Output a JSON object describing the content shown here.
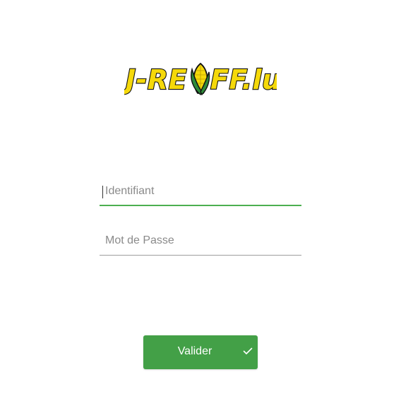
{
  "brand": {
    "logo_text": "J-REIFF.lu",
    "logo_icon": "corn-cob-icon",
    "colors": {
      "yellow": "#f5d90a",
      "outline": "#111111",
      "leaf_green": "#2e8b3a"
    }
  },
  "form": {
    "username": {
      "placeholder": "Identifiant",
      "value": ""
    },
    "password": {
      "placeholder": "Mot de Passe",
      "value": ""
    },
    "submit": {
      "label": "Valider",
      "icon": "check-icon"
    }
  },
  "theme": {
    "accent": "#4caf50",
    "button": "#43a047",
    "underline": "#9e9e9e"
  }
}
